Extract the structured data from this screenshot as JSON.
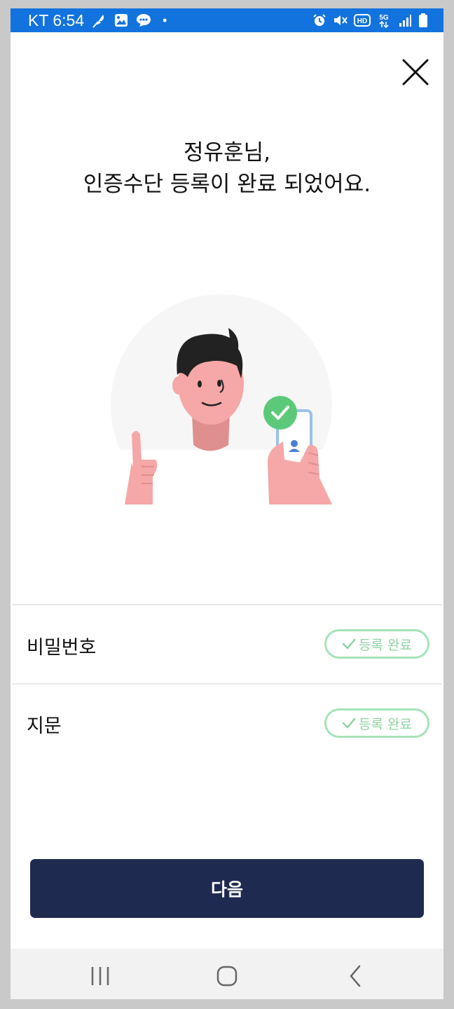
{
  "status_bar": {
    "carrier_time": "KT 6:54",
    "dot": "•",
    "icons_left": [
      "feather-icon",
      "image-icon",
      "chat-bubble-icon"
    ],
    "icons_right": [
      "alarm-icon",
      "mute-icon",
      "hd-icon",
      "5g-icon",
      "signal-icon",
      "battery-icon"
    ],
    "hd_label": "HD",
    "fiveg_label": "5G"
  },
  "header": {
    "title_line1": "정유훈님,",
    "title_line2": "인증수단 등록이 완료 되었어요."
  },
  "methods": [
    {
      "label": "비밀번호",
      "status": "등록 완료"
    },
    {
      "label": "지문",
      "status": "등록 완료"
    }
  ],
  "next_button": {
    "label": "다음"
  },
  "colors": {
    "status_bar": "#1273de",
    "button": "#1f2a50",
    "badge_border": "#a6e3b7",
    "badge_text": "#8fd3a2",
    "check_circle": "#5cc97a",
    "skin": "#f6a7a7",
    "hair": "#222222"
  }
}
